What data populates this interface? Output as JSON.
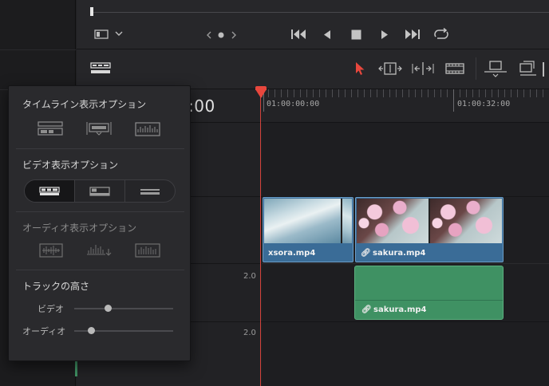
{
  "timeline": {
    "timecode": ":00",
    "ruler_labels": [
      "01:00:00:00",
      "01:00:32:00"
    ],
    "track_levels": [
      "2.0",
      "2.0"
    ]
  },
  "clips": {
    "video": [
      {
        "name": "xsora.mp4",
        "linked": false
      },
      {
        "name": "sakura.mp4",
        "linked": true
      }
    ],
    "audio": [
      {
        "name": "sakura.mp4",
        "linked": true
      }
    ]
  },
  "popup": {
    "timeline_options_title": "タイムライン表示オプション",
    "video_options_title": "ビデオ表示オプション",
    "audio_options_title": "オーディオ表示オプション",
    "track_height_title": "トラックの高さ",
    "video_label": "ビデオ",
    "audio_label": "オーディオ",
    "video_height": 0.33,
    "audio_height": 0.15
  },
  "colors": {
    "playhead": "#e8473d",
    "video_clip": "#3a6c97",
    "audio_clip": "#3f9163",
    "selection_tool": "#e8473d"
  },
  "icons": {
    "toolbar": [
      "viewer-layout-icon",
      "chevron-down-icon",
      "jog-left-icon",
      "jog-dot-icon",
      "jog-right-icon",
      "go-to-start-icon",
      "step-back-icon",
      "stop-icon",
      "play-icon",
      "go-to-end-icon",
      "loop-icon"
    ],
    "edit_tools": [
      "timeline-view-options-icon",
      "selection-tool-icon",
      "trim-tool-icon",
      "dynamic-trim-icon",
      "blade-tool-icon",
      "insert-clip-icon",
      "overwrite-clip-icon"
    ]
  }
}
